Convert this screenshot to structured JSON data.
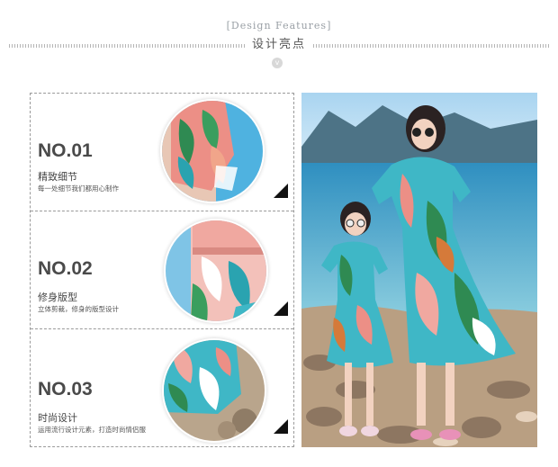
{
  "header": {
    "en_title": "[Design Features]",
    "cn_title": "设计亮点",
    "chevron": "v"
  },
  "features": [
    {
      "number": "NO.01",
      "title": "精致细节",
      "desc": "每一处细节我们都用心制作"
    },
    {
      "number": "NO.02",
      "title": "修身版型",
      "desc": "立体剪裁，修身的版型设计"
    },
    {
      "number": "NO.03",
      "title": "时尚设计",
      "desc": "运用流行设计元素，打造时尚情侣服"
    }
  ],
  "colors": {
    "accent_dark": "#4a4a4a",
    "sea": "#4aa3c6",
    "sky": "#bfe0f4"
  }
}
